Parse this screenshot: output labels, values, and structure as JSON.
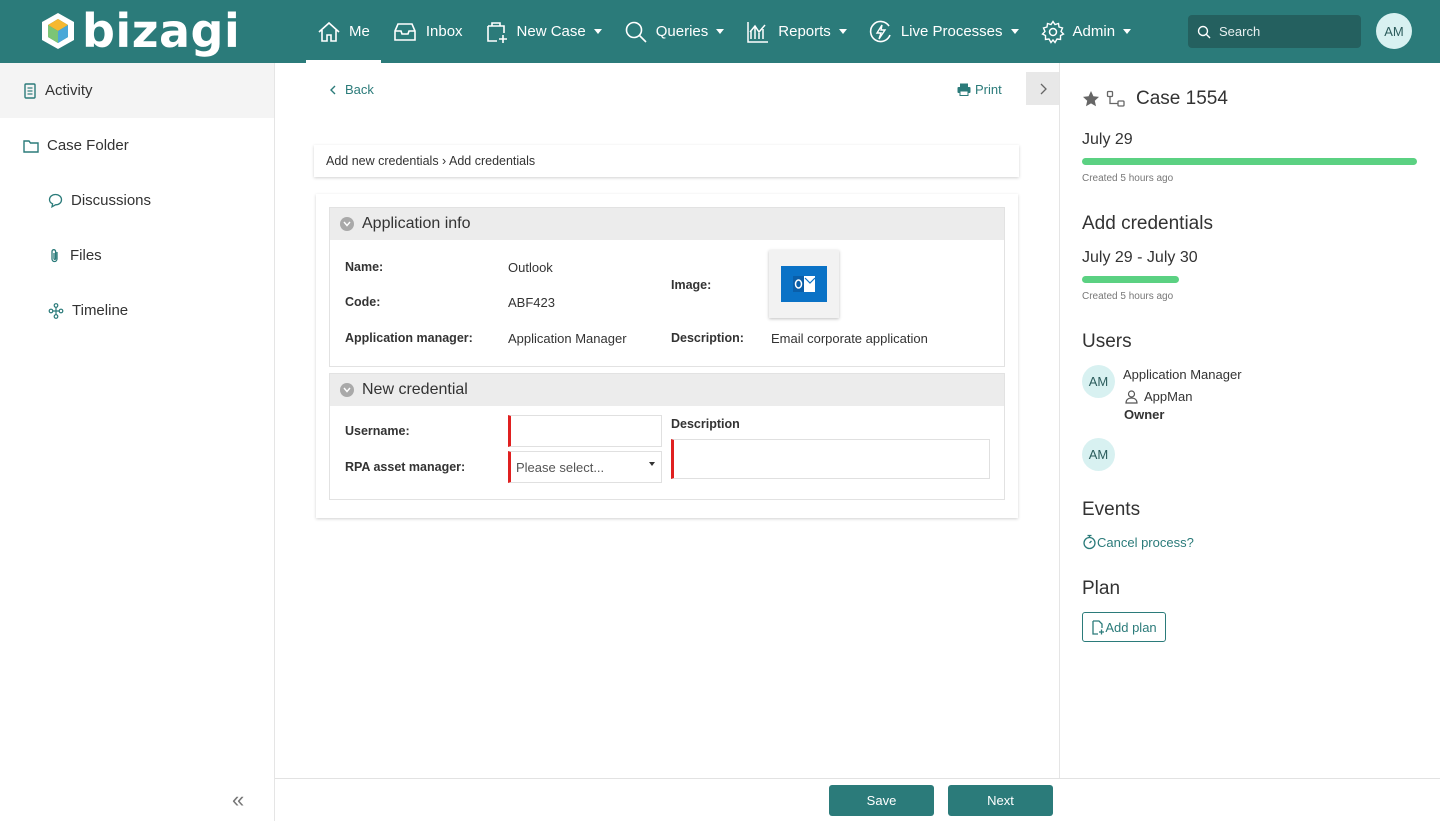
{
  "brand": {
    "name": "bizagi"
  },
  "nav": {
    "items": [
      {
        "label": "Me",
        "icon": "home-icon"
      },
      {
        "label": "Inbox",
        "icon": "inbox-icon"
      },
      {
        "label": "New Case",
        "icon": "new-case-icon"
      },
      {
        "label": "Queries",
        "icon": "search-icon"
      },
      {
        "label": "Reports",
        "icon": "chart-icon"
      },
      {
        "label": "Live Processes",
        "icon": "bolt-icon"
      },
      {
        "label": "Admin",
        "icon": "gear-icon"
      }
    ],
    "search_placeholder": "Search",
    "avatar": "AM"
  },
  "sidebar": {
    "items": [
      {
        "label": "Activity",
        "icon": "document-icon"
      },
      {
        "label": "Case Folder",
        "icon": "folder-icon"
      },
      {
        "label": "Discussions",
        "icon": "chat-icon"
      },
      {
        "label": "Files",
        "icon": "paperclip-icon"
      },
      {
        "label": "Timeline",
        "icon": "timeline-icon"
      }
    ]
  },
  "main": {
    "back": "Back",
    "print": "Print",
    "breadcrumb": "Add new credentials › Add credentials",
    "app_info": {
      "title": "Application info",
      "name_label": "Name:",
      "name_value": "Outlook",
      "code_label": "Code:",
      "code_value": "ABF423",
      "manager_label": "Application manager:",
      "manager_value": "Application Manager",
      "image_label": "Image:",
      "description_label": "Description:",
      "description_value": "Email corporate application"
    },
    "new_credential": {
      "title": "New credential",
      "username_label": "Username:",
      "username_value": "",
      "rpa_label": "RPA asset manager:",
      "rpa_placeholder": "Please select...",
      "description_label": "Description",
      "description_value": ""
    }
  },
  "actions": {
    "save": "Save",
    "next": "Next"
  },
  "right": {
    "case_title": "Case 1554",
    "case_date": "July 29",
    "case_meta": "Created 5 hours ago",
    "task_title": "Add credentials",
    "task_dates": "July 29 - July 30",
    "task_meta": "Created 5 hours ago",
    "users_title": "Users",
    "user1": {
      "avatar": "AM",
      "name": "Application Manager",
      "login": "AppMan",
      "role": "Owner"
    },
    "user2": {
      "avatar": "AM"
    },
    "events_title": "Events",
    "cancel_process": "Cancel process?",
    "plan_title": "Plan",
    "add_plan": "Add plan"
  },
  "colors": {
    "primary": "#2b7b7a",
    "progress": "#5bd182",
    "required": "#e02020"
  }
}
